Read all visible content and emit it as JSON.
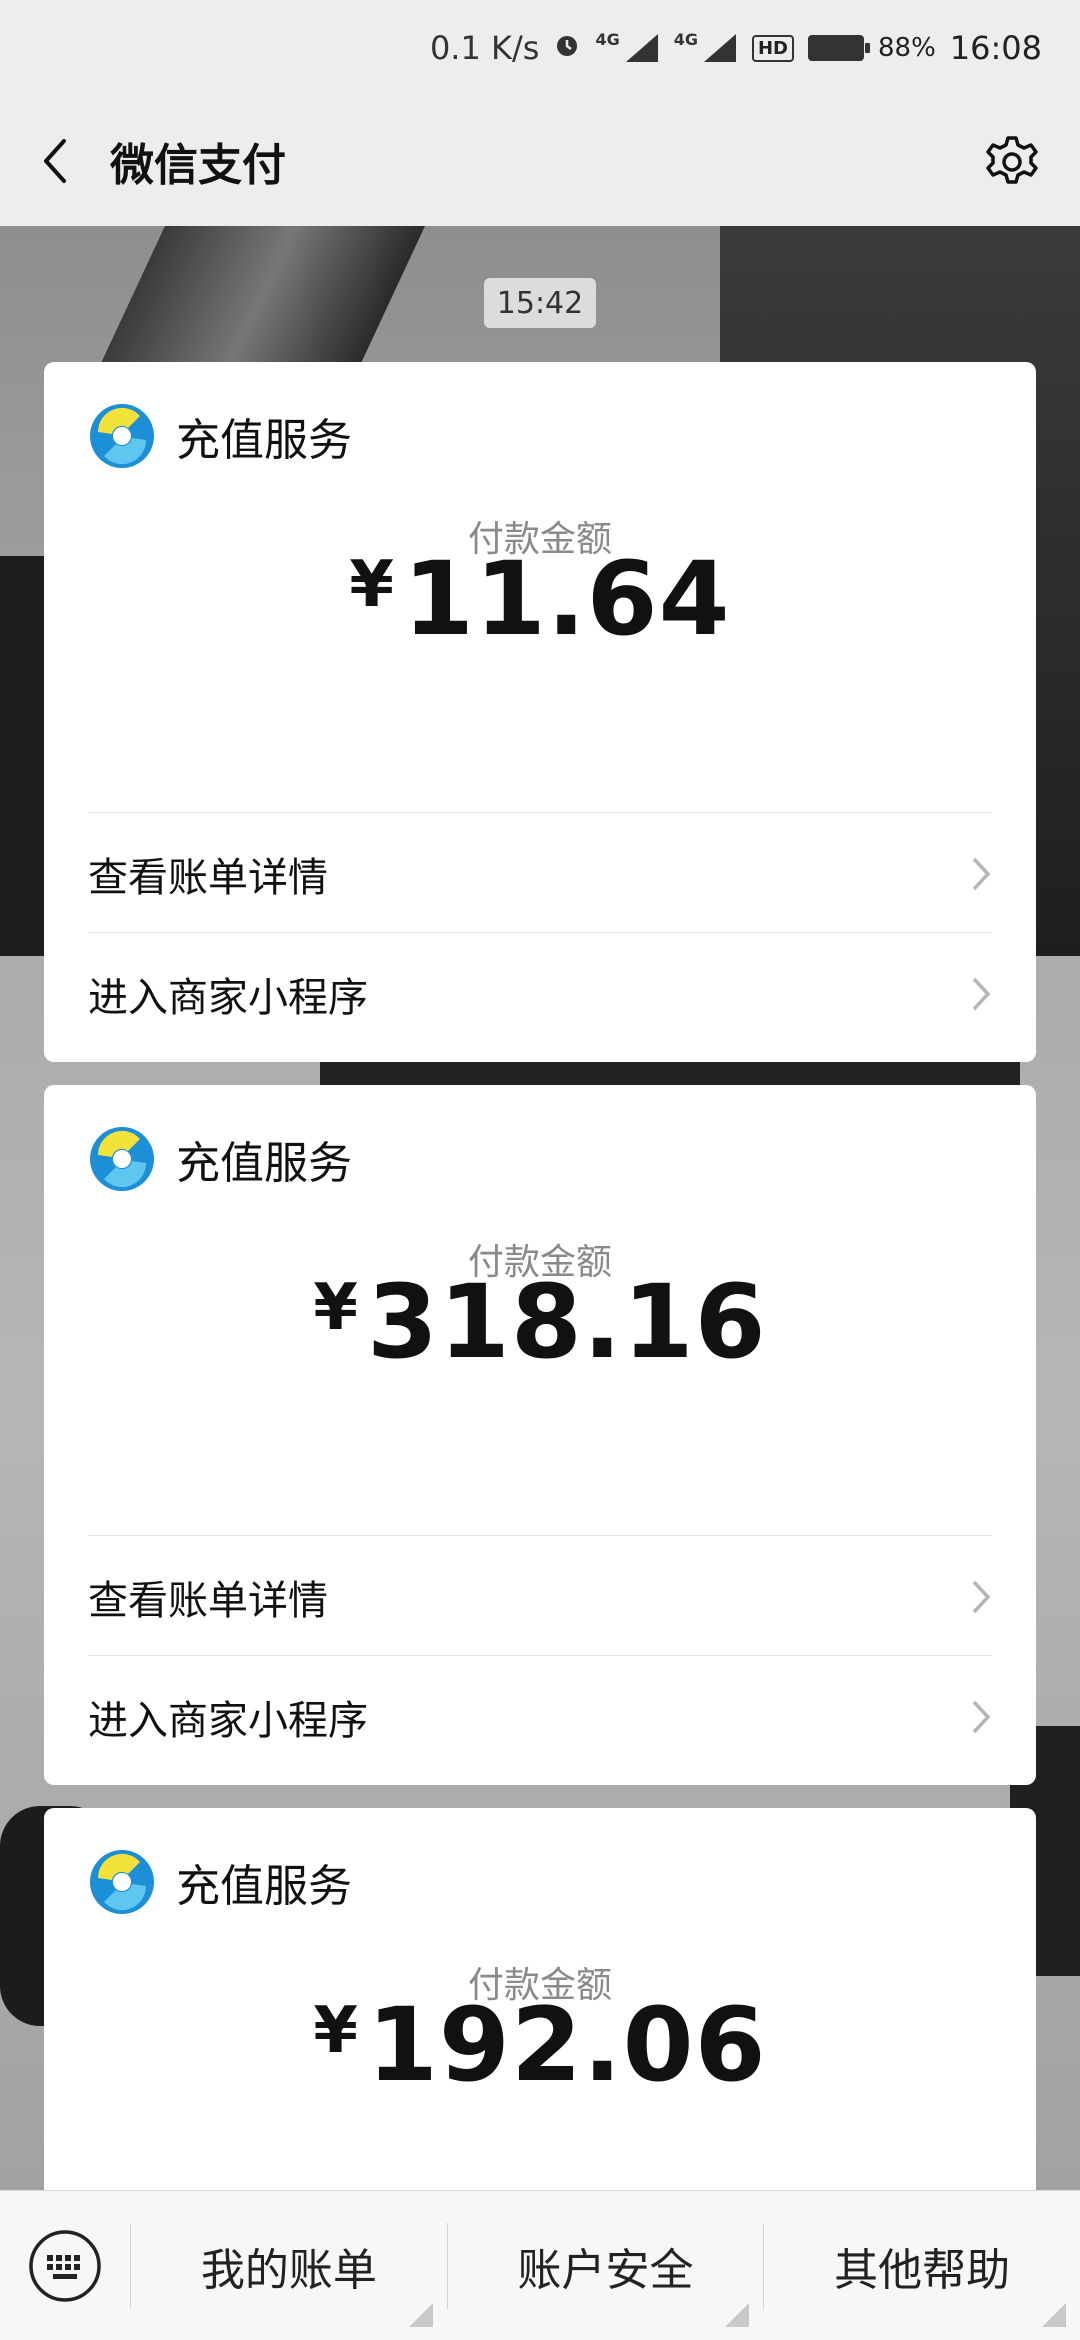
{
  "status_bar": {
    "network_speed": "0.1 K/s",
    "sim1_tag": "4G",
    "sim2_tag": "4G",
    "hd_label": "HD",
    "battery_percent": "88%",
    "time": "16:08"
  },
  "nav": {
    "title": "微信支付"
  },
  "chat": {
    "timestamp": "15:42",
    "cards": [
      {
        "merchant": "充值服务",
        "amount_label": "付款金额",
        "currency": "¥",
        "amount": "11.64",
        "link1": "查看账单详情",
        "link2": "进入商家小程序"
      },
      {
        "merchant": "充值服务",
        "amount_label": "付款金额",
        "currency": "¥",
        "amount": "318.16",
        "link1": "查看账单详情",
        "link2": "进入商家小程序"
      },
      {
        "merchant": "充值服务",
        "amount_label": "付款金额",
        "currency": "¥",
        "amount": "192.06"
      }
    ]
  },
  "bottom_menu": {
    "tabs": [
      "我的账单",
      "账户安全",
      "其他帮助"
    ]
  },
  "icons": {
    "back": "back-arrow-icon",
    "settings": "gear-icon",
    "keyboard": "keyboard-icon",
    "merchant_logo": "merchant-logo-icon",
    "chevron": "chevron-right-icon"
  }
}
